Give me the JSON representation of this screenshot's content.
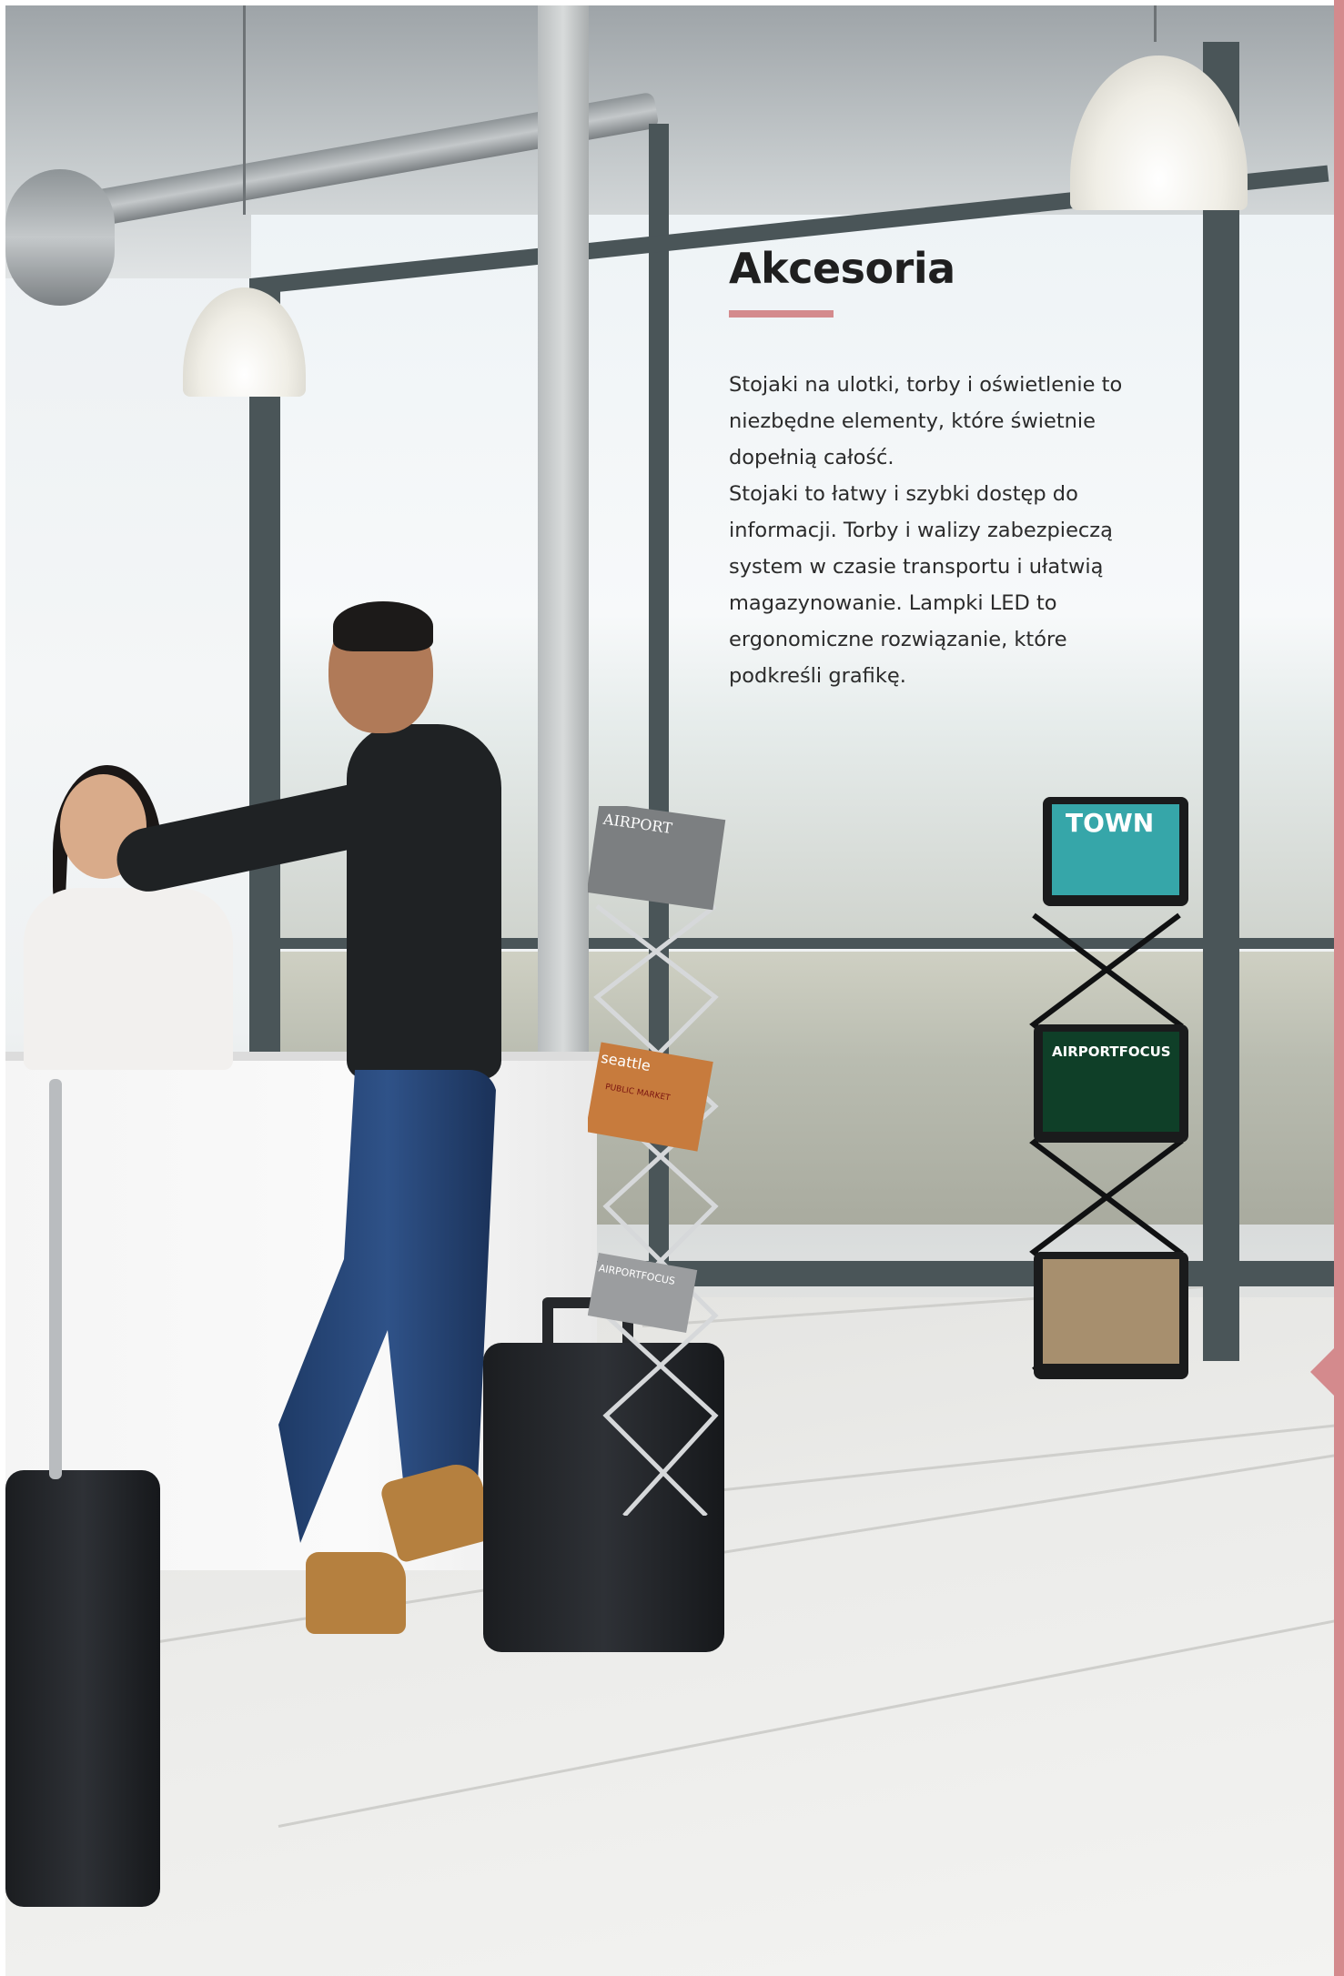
{
  "heading": "Akcesoria",
  "accent_color": "#d48a8d",
  "body_lines": [
    "Stojaki na ulotki, torby i oświetlenie to",
    "niezbędne elementy, które świetnie",
    "dopełnią całość.",
    "Stojaki to łatwy i szybki dostęp do",
    "informacji. Torby i walizy zabezpieczą",
    "system w czasie transportu i ułatwią",
    "magazynowanie. Lampki LED to",
    "ergonomiczne rozwiązanie, które",
    "podkreśli grafikę."
  ],
  "photo": {
    "magazine_labels": [
      "TOWN",
      "AIRPORT",
      "AIRPORTFOCUS",
      "seattle",
      "PUBLIC MARKET",
      "AIRPORTFOCUS"
    ]
  }
}
